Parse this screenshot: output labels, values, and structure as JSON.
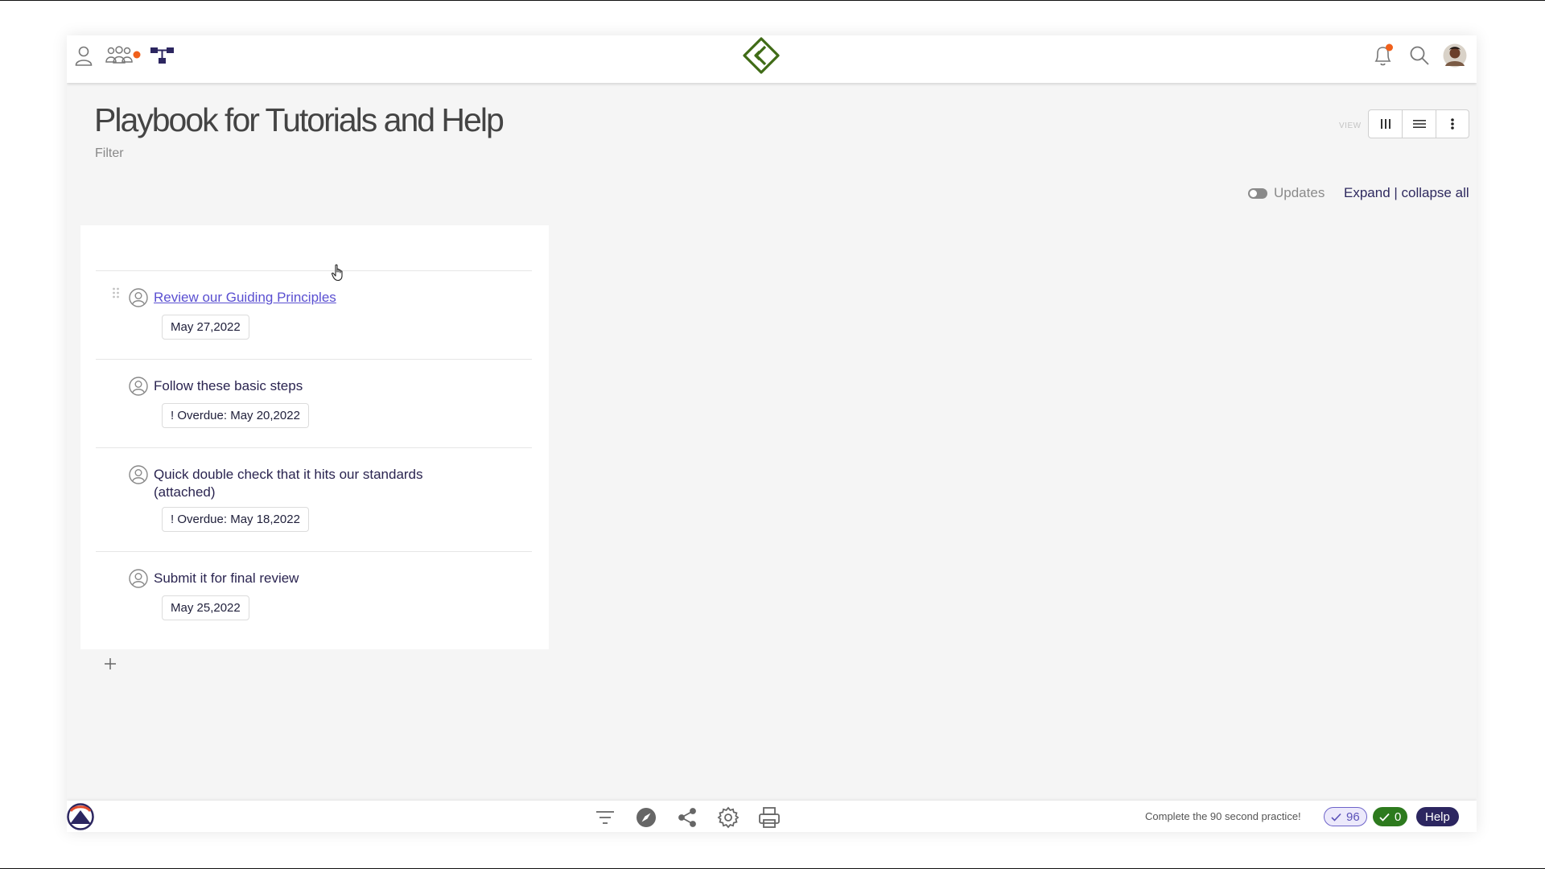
{
  "header": {
    "icons": [
      "person-icon",
      "team-icon",
      "org-chart-icon",
      "bell-icon",
      "search-icon",
      "avatar"
    ],
    "notification_color": "#f0601b"
  },
  "page": {
    "title": "Playbook for Tutorials and Help",
    "filter_label": "Filter",
    "view_label": "VIEW",
    "updates_label": "Updates",
    "expand_label": "Expand | collapse all"
  },
  "tasks": [
    {
      "name": "Review our Guiding Principles",
      "date": "May 27,2022",
      "link": true
    },
    {
      "name": "Follow these basic steps",
      "date": "! Overdue: May 20,2022",
      "link": false
    },
    {
      "name": "Quick double check that it hits our standards",
      "name2": "(attached)",
      "date": "! Overdue: May 18,2022",
      "link": false
    },
    {
      "name": "Submit it for final review",
      "date": "May 25,2022",
      "link": false
    }
  ],
  "footer": {
    "practice_text": "Complete the 90 second practice!",
    "badge_pending": "96",
    "badge_done": "0",
    "help_label": "Help"
  },
  "colors": {
    "accent": "#2c2660",
    "link": "#5a4fd1",
    "success": "#2d7a1e",
    "logo_green": "#3f6b16"
  }
}
